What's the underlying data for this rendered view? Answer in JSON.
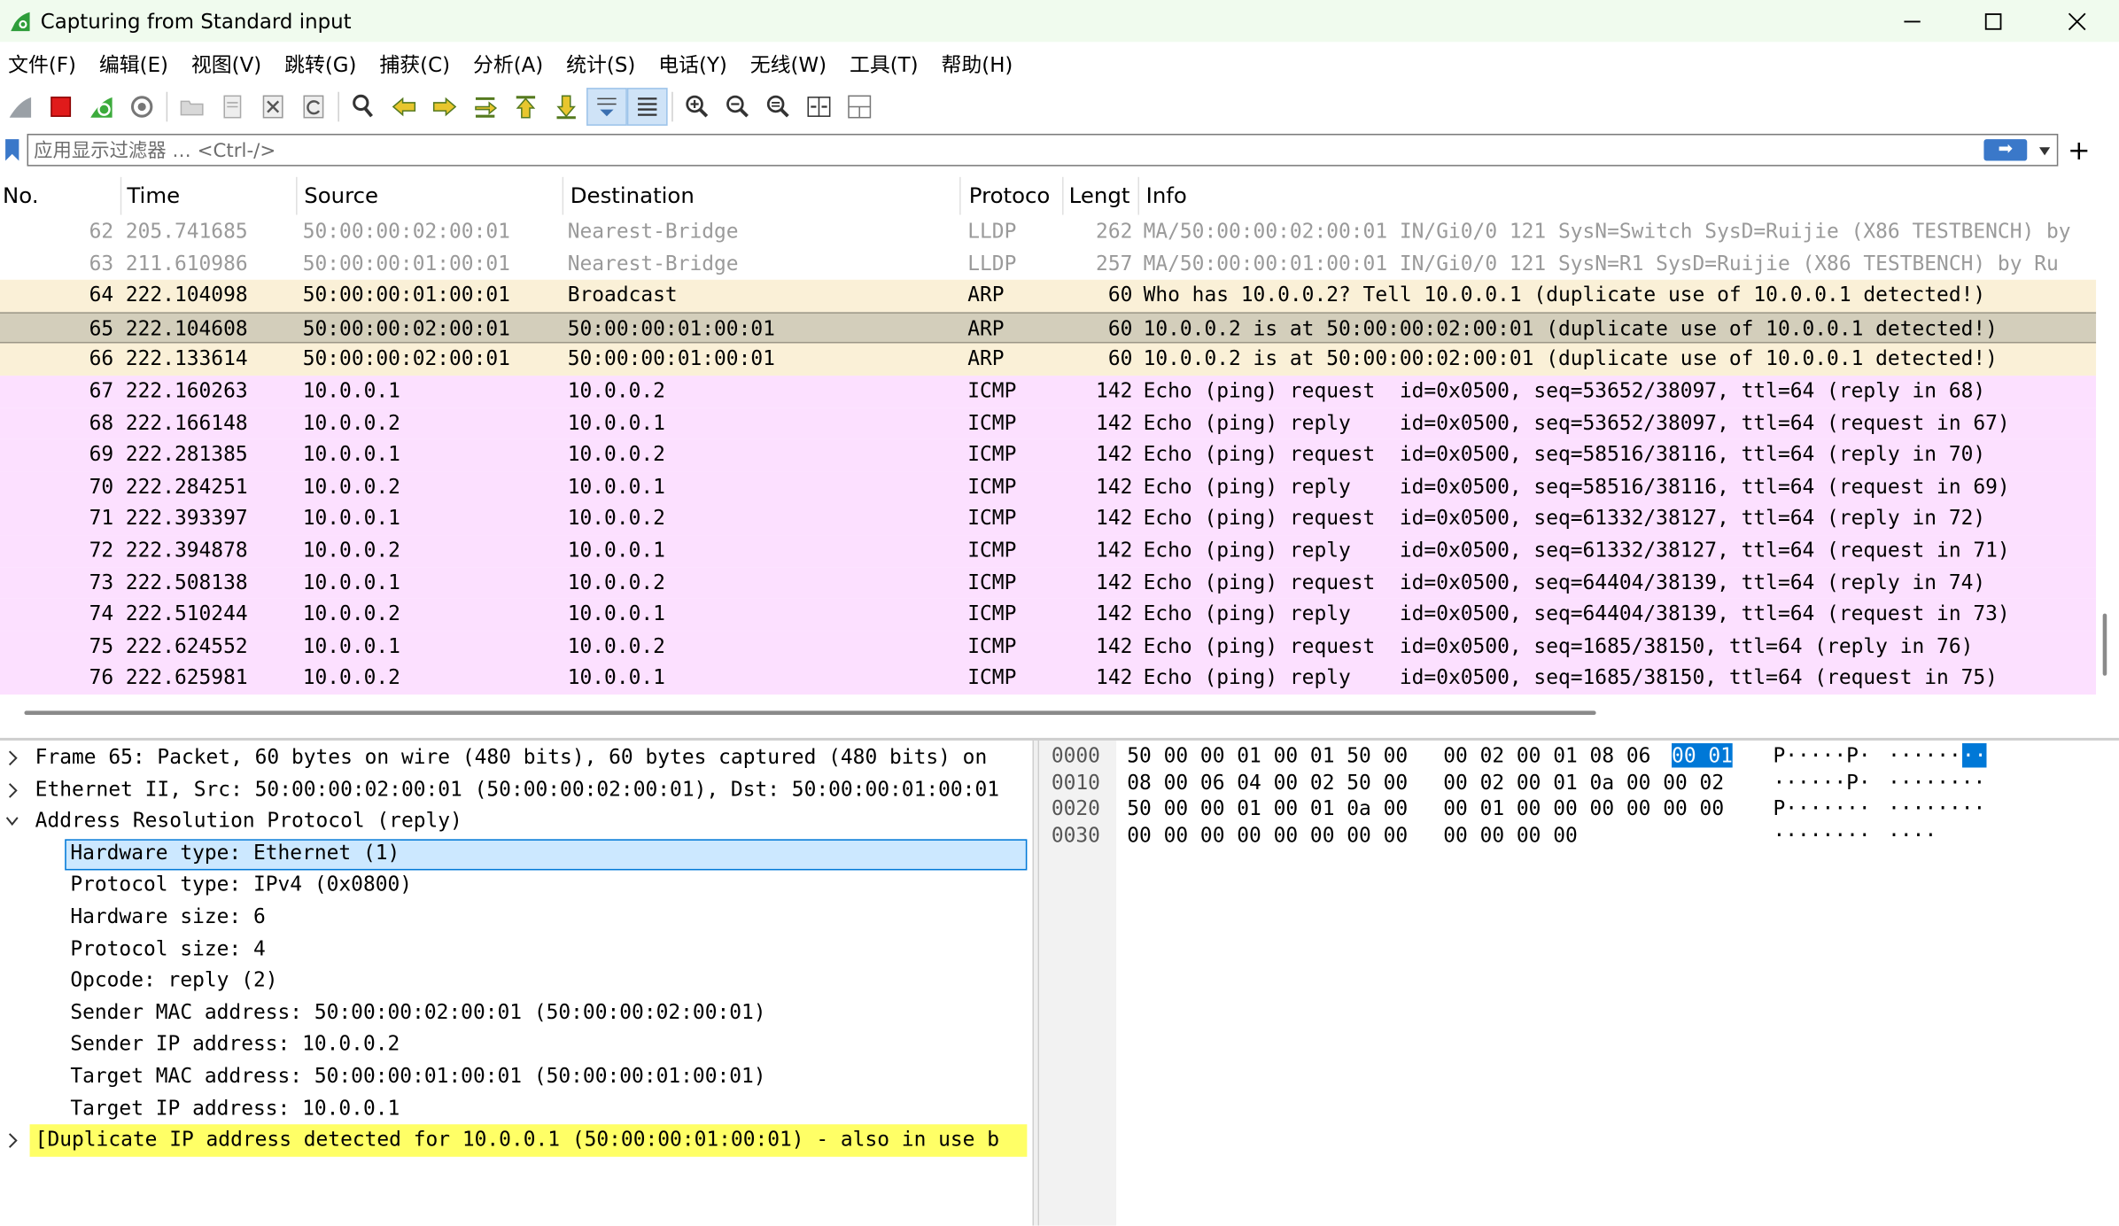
{
  "window": {
    "title": "Capturing from Standard input"
  },
  "menu": [
    "文件(F)",
    "编辑(E)",
    "视图(V)",
    "跳转(G)",
    "捕获(C)",
    "分析(A)",
    "统计(S)",
    "电话(Y)",
    "无线(W)",
    "工具(T)",
    "帮助(H)"
  ],
  "toolbar": {
    "icons": [
      "shark-fin-start-icon",
      "stop-icon",
      "restart-icon",
      "options-gear-icon",
      "open-folder-icon",
      "save-file-icon",
      "close-file-icon",
      "reload-icon",
      "find-icon",
      "back-arrow-icon",
      "forward-arrow-icon",
      "go-to-packet-icon",
      "first-packet-icon",
      "last-packet-icon",
      "autoscroll-icon",
      "colorize-icon",
      "zoom-in-icon",
      "zoom-out-icon",
      "normal-size-icon",
      "resize-columns-icon",
      "layout-icon"
    ]
  },
  "filter": {
    "placeholder": "应用显示过滤器 … <Ctrl-/>",
    "apply_label": "➡",
    "add_label": "+"
  },
  "packet_list": {
    "columns": [
      "No.",
      "Time",
      "Source",
      "Destination",
      "Protoco",
      "Lengt",
      "Info"
    ],
    "rows": [
      {
        "no": "62",
        "time": "205.741685",
        "src": "50:00:00:02:00:01",
        "dst": "Nearest-Bridge",
        "proto": "LLDP",
        "len": "262",
        "info": "MA/50:00:00:02:00:01 IN/Gi0/0 121 SysN=Switch SysD=Ruijie (X86 TESTBENCH) by",
        "kind": "lldp"
      },
      {
        "no": "63",
        "time": "211.610986",
        "src": "50:00:00:01:00:01",
        "dst": "Nearest-Bridge",
        "proto": "LLDP",
        "len": "257",
        "info": "MA/50:00:00:01:00:01 IN/Gi0/0 121 SysN=R1 SysD=Ruijie (X86 TESTBENCH) by Ru",
        "kind": "lldp"
      },
      {
        "no": "64",
        "time": "222.104098",
        "src": "50:00:00:01:00:01",
        "dst": "Broadcast",
        "proto": "ARP",
        "len": "60",
        "info": "Who has 10.0.0.2? Tell 10.0.0.1 (duplicate use of 10.0.0.1 detected!)",
        "kind": "arp"
      },
      {
        "no": "65",
        "time": "222.104608",
        "src": "50:00:00:02:00:01",
        "dst": "50:00:00:01:00:01",
        "proto": "ARP",
        "len": "60",
        "info": "10.0.0.2 is at 50:00:00:02:00:01 (duplicate use of 10.0.0.1 detected!)",
        "kind": "arp sel"
      },
      {
        "no": "66",
        "time": "222.133614",
        "src": "50:00:00:02:00:01",
        "dst": "50:00:00:01:00:01",
        "proto": "ARP",
        "len": "60",
        "info": "10.0.0.2 is at 50:00:00:02:00:01 (duplicate use of 10.0.0.1 detected!)",
        "kind": "arp"
      },
      {
        "no": "67",
        "time": "222.160263",
        "src": "10.0.0.1",
        "dst": "10.0.0.2",
        "proto": "ICMP",
        "len": "142",
        "info": "Echo (ping) request  id=0x0500, seq=53652/38097, ttl=64 (reply in 68)",
        "kind": "icmp"
      },
      {
        "no": "68",
        "time": "222.166148",
        "src": "10.0.0.2",
        "dst": "10.0.0.1",
        "proto": "ICMP",
        "len": "142",
        "info": "Echo (ping) reply    id=0x0500, seq=53652/38097, ttl=64 (request in 67)",
        "kind": "icmp"
      },
      {
        "no": "69",
        "time": "222.281385",
        "src": "10.0.0.1",
        "dst": "10.0.0.2",
        "proto": "ICMP",
        "len": "142",
        "info": "Echo (ping) request  id=0x0500, seq=58516/38116, ttl=64 (reply in 70)",
        "kind": "icmp"
      },
      {
        "no": "70",
        "time": "222.284251",
        "src": "10.0.0.2",
        "dst": "10.0.0.1",
        "proto": "ICMP",
        "len": "142",
        "info": "Echo (ping) reply    id=0x0500, seq=58516/38116, ttl=64 (request in 69)",
        "kind": "icmp"
      },
      {
        "no": "71",
        "time": "222.393397",
        "src": "10.0.0.1",
        "dst": "10.0.0.2",
        "proto": "ICMP",
        "len": "142",
        "info": "Echo (ping) request  id=0x0500, seq=61332/38127, ttl=64 (reply in 72)",
        "kind": "icmp"
      },
      {
        "no": "72",
        "time": "222.394878",
        "src": "10.0.0.2",
        "dst": "10.0.0.1",
        "proto": "ICMP",
        "len": "142",
        "info": "Echo (ping) reply    id=0x0500, seq=61332/38127, ttl=64 (request in 71)",
        "kind": "icmp"
      },
      {
        "no": "73",
        "time": "222.508138",
        "src": "10.0.0.1",
        "dst": "10.0.0.2",
        "proto": "ICMP",
        "len": "142",
        "info": "Echo (ping) request  id=0x0500, seq=64404/38139, ttl=64 (reply in 74)",
        "kind": "icmp"
      },
      {
        "no": "74",
        "time": "222.510244",
        "src": "10.0.0.2",
        "dst": "10.0.0.1",
        "proto": "ICMP",
        "len": "142",
        "info": "Echo (ping) reply    id=0x0500, seq=64404/38139, ttl=64 (request in 73)",
        "kind": "icmp"
      },
      {
        "no": "75",
        "time": "222.624552",
        "src": "10.0.0.1",
        "dst": "10.0.0.2",
        "proto": "ICMP",
        "len": "142",
        "info": "Echo (ping) request  id=0x0500, seq=1685/38150, ttl=64 (reply in 76)",
        "kind": "icmp"
      },
      {
        "no": "76",
        "time": "222.625981",
        "src": "10.0.0.2",
        "dst": "10.0.0.1",
        "proto": "ICMP",
        "len": "142",
        "info": "Echo (ping) reply    id=0x0500, seq=1685/38150, ttl=64 (request in 75)",
        "kind": "icmp"
      }
    ]
  },
  "details": {
    "rows": [
      {
        "text": "Frame 65: Packet, 60 bytes on wire (480 bits), 60 bytes captured (480 bits) on",
        "level": 0,
        "expander": "collapsed"
      },
      {
        "text": "Ethernet II, Src: 50:00:00:02:00:01 (50:00:00:02:00:01), Dst: 50:00:00:01:00:01",
        "level": 0,
        "expander": "collapsed"
      },
      {
        "text": "Address Resolution Protocol (reply)",
        "level": 0,
        "expander": "expanded"
      },
      {
        "text": "Hardware type: Ethernet (1)",
        "level": 1,
        "expander": "none",
        "selected": true
      },
      {
        "text": "Protocol type: IPv4 (0x0800)",
        "level": 1,
        "expander": "none"
      },
      {
        "text": "Hardware size: 6",
        "level": 1,
        "expander": "none"
      },
      {
        "text": "Protocol size: 4",
        "level": 1,
        "expander": "none"
      },
      {
        "text": "Opcode: reply (2)",
        "level": 1,
        "expander": "none"
      },
      {
        "text": "Sender MAC address: 50:00:00:02:00:01 (50:00:00:02:00:01)",
        "level": 1,
        "expander": "none"
      },
      {
        "text": "Sender IP address: 10.0.0.2",
        "level": 1,
        "expander": "none"
      },
      {
        "text": "Target MAC address: 50:00:00:01:00:01 (50:00:00:01:00:01)",
        "level": 1,
        "expander": "none"
      },
      {
        "text": "Target IP address: 10.0.0.1",
        "level": 1,
        "expander": "none"
      },
      {
        "text": "[Duplicate IP address detected for 10.0.0.1 (50:00:00:01:00:01) - also in use b",
        "level": 0,
        "expander": "collapsed",
        "warning": true
      }
    ]
  },
  "bytes": {
    "rows": [
      {
        "offset": "0000",
        "hex_a": "50 00 00 01 00 01 50 00",
        "hex_b": "00 02 00 01 08 06",
        "hex_hl": "00 01",
        "ascii_a": "P·····P·",
        "ascii_b": "······",
        "ascii_hl": "··"
      },
      {
        "offset": "0010",
        "hex_a": "08 00 06 04 00 02 50 00",
        "hex_b": "00 02 00 01 0a 00 00 02",
        "hex_hl": "",
        "ascii_a": "······P·",
        "ascii_b": "········",
        "ascii_hl": ""
      },
      {
        "offset": "0020",
        "hex_a": "50 00 00 01 00 01 0a 00",
        "hex_b": "00 01 00 00 00 00 00 00",
        "hex_hl": "",
        "ascii_a": "P·······",
        "ascii_b": "········",
        "ascii_hl": ""
      },
      {
        "offset": "0030",
        "hex_a": "00 00 00 00 00 00 00 00",
        "hex_b": "00 00 00 00",
        "hex_hl": "",
        "ascii_a": "········",
        "ascii_b": "····",
        "ascii_hl": ""
      }
    ]
  },
  "colors": {
    "lldp_text": "#9a9a9a",
    "arp_row": "#faf0d7",
    "arp_selected": "#d3cebb",
    "icmp_row": "#fce0ff",
    "detail_selected": "#cce8ff",
    "warning": "#ffff66",
    "byte_highlight": "#0078d7"
  }
}
